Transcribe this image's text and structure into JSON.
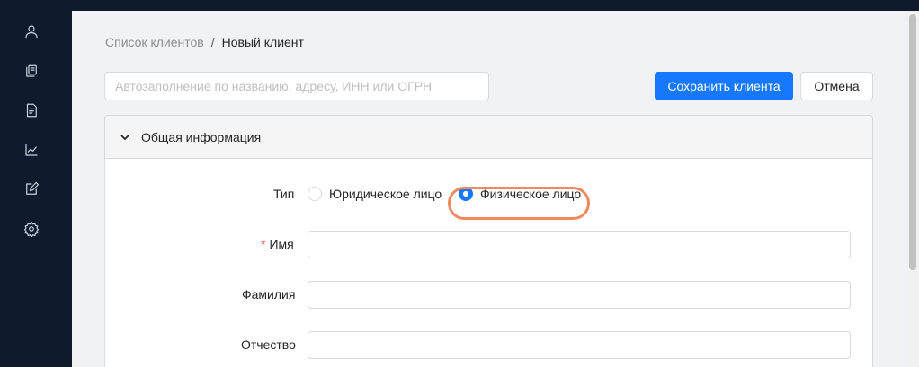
{
  "sidebar": {
    "items": [
      {
        "icon": "user-icon"
      },
      {
        "icon": "copy-document-icon"
      },
      {
        "icon": "invoice-document-icon"
      },
      {
        "icon": "line-chart-icon"
      },
      {
        "icon": "edit-square-icon"
      },
      {
        "icon": "settings-gear-icon"
      }
    ]
  },
  "breadcrumb": {
    "parent": "Список клиентов",
    "separator": "/",
    "current": "Новый клиент"
  },
  "autofill": {
    "placeholder": "Автозаполнение по названию, адресу, ИНН или ОГРН",
    "value": ""
  },
  "actions": {
    "save_label": "Сохранить клиента",
    "cancel_label": "Отмена"
  },
  "panel": {
    "title": "Общая информация",
    "type": {
      "label": "Тип",
      "options": [
        "Юридическое лицо",
        "Физическое лицо"
      ],
      "selected": "Физическое лицо"
    },
    "first_name": {
      "label": "Имя",
      "required_mark": "*",
      "value": ""
    },
    "last_name": {
      "label": "Фамилия",
      "value": ""
    },
    "patronymic": {
      "label": "Отчество",
      "value": ""
    }
  },
  "colors": {
    "sidebar_bg": "#0f1b2d",
    "primary": "#1677ff",
    "highlight": "#ef8a5e",
    "required": "#ff4d4f"
  }
}
